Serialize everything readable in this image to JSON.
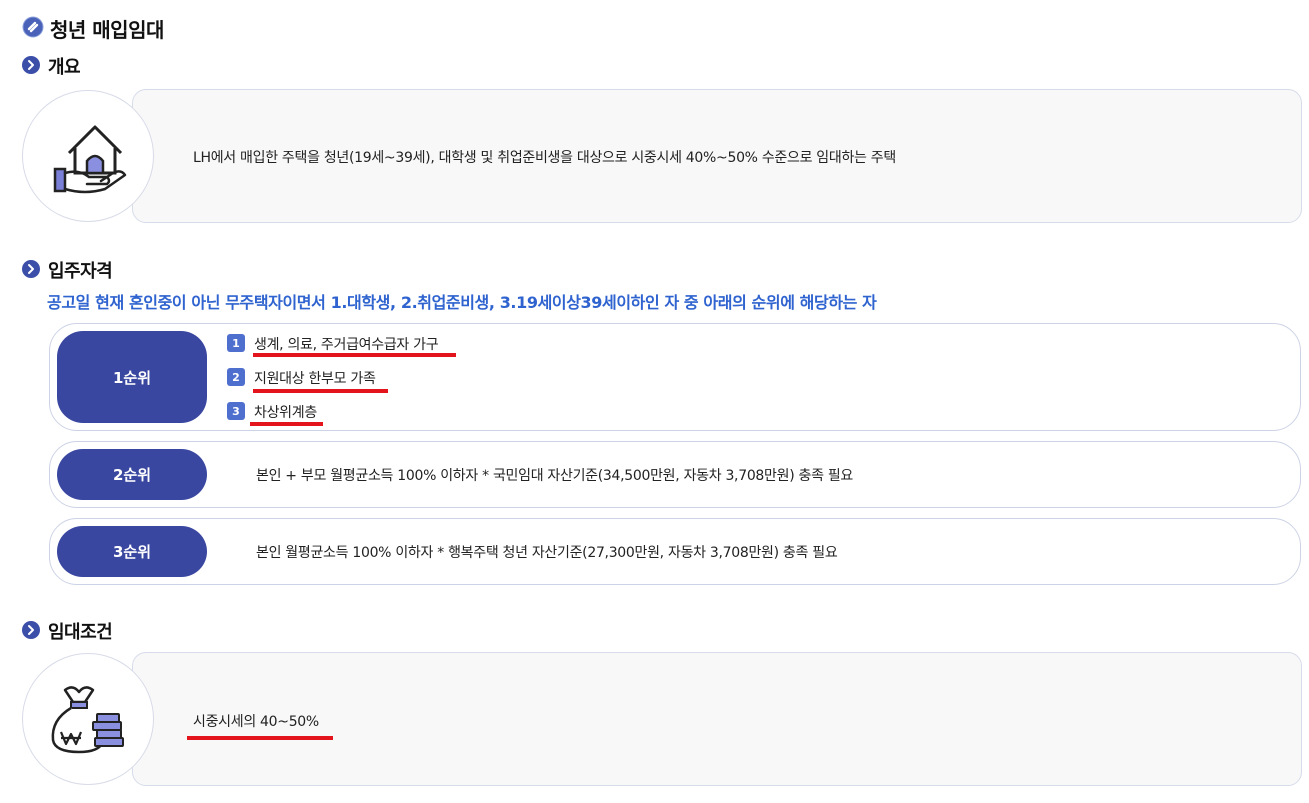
{
  "page": {
    "title": "청년 매입임대"
  },
  "overview": {
    "heading": "개요",
    "text": "LH에서 매입한 주택을 청년(19세~39세), 대학생 및 취업준비생을 대상으로 시중시세 40%~50% 수준으로 임대하는 주택",
    "icon": "house-in-hand-icon"
  },
  "qualification": {
    "heading": "입주자격",
    "note": "공고일 현재 혼인중이 아닌 무주택자이면서 1.대학생, 2.취업준비생, 3.19세이상39세이하인 자 중 아래의 순위에 해당하는 자",
    "ranks": [
      {
        "label": "1순위",
        "items": [
          {
            "num": "1",
            "text": "생계, 의료, 주거급여수급자 가구"
          },
          {
            "num": "2",
            "text": "지원대상 한부모 가족"
          },
          {
            "num": "3",
            "text": "차상위계층"
          }
        ]
      },
      {
        "label": "2순위",
        "text": "본인 + 부모 월평균소득 100% 이하자 * 국민임대 자산기준(34,500만원, 자동차 3,708만원) 충족 필요"
      },
      {
        "label": "3순위",
        "text": "본인 월평균소득 100% 이하자 * 행복주택 청년 자산기준(27,300만원, 자동차 3,708만원) 충족 필요"
      }
    ]
  },
  "lease": {
    "heading": "임대조건",
    "text": "시중시세의 40~50%",
    "icon": "money-bag-coins-icon"
  },
  "colors": {
    "accent": "#3a47a0",
    "note": "#2f63cf",
    "underline": "#e3141c",
    "badge": "#4f6fcf"
  }
}
